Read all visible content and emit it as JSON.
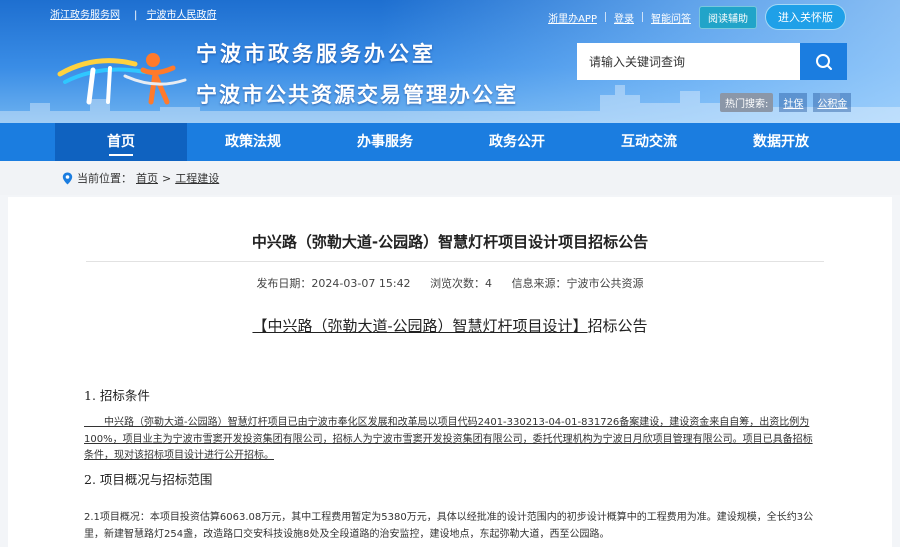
{
  "top_links": [
    "浙江政务服务网",
    "宁波市人民政府"
  ],
  "userbar": {
    "app": "浙里办APP",
    "login": "登录",
    "smart_qa": "智能问答",
    "assist": "阅读辅助",
    "old_version": "进入关怀版"
  },
  "header": {
    "title1": "宁波市政务服务办公室",
    "title2": "宁波市公共资源交易管理办公室"
  },
  "search": {
    "placeholder": "请输入关键词查询"
  },
  "hot_search": {
    "label": "热门搜索:",
    "tags": [
      "社保",
      "公积金"
    ]
  },
  "nav": {
    "items": [
      "首页",
      "政策法规",
      "办事服务",
      "政务公开",
      "互动交流",
      "数据开放"
    ],
    "active": "首页"
  },
  "breadcrumb": {
    "prefix": "当前位置：",
    "home": "首页",
    "sep": ">",
    "current": "工程建设"
  },
  "article": {
    "title": "中兴路（弥勒大道-公园路）智慧灯杆项目设计项目招标公告",
    "meta": {
      "date": "发布日期：2024-03-07 15:42",
      "views": "浏览次数：4",
      "source": "信息来源：宁波市公共资源"
    },
    "subtitle_bracketed": "【中兴路（弥勒大道-公园路）智慧灯杆项目设计】",
    "subtitle_rest": "招标公告",
    "sections": [
      {
        "heading": "1. 招标条件",
        "text": "　　中兴路（弥勒大道-公园路）智慧灯杆项目已由宁波市奉化区发展和改革局以项目代码2401-330213-04-01-831726备案建设，建设资金来自自筹，出资比例为100%，项目业主为宁波市雪窦开发投资集团有限公司，招标人为宁波市雪窦开发投资集团有限公司，委托代理机构为宁波日月欣项目管理有限公司。项目已具备招标 条件，现对该招标项目设计进行公开招标。"
      },
      {
        "heading": "2. 项目概况与招标范围",
        "text": "2.1项目概况：本项目投资估算6063.08万元，其中工程费用暂定为5380万元，具体以经批准的设计范围内的初步设计概算中的工程费用为准。建设规模，全长约3公里，新建智慧路灯254盏，改造路口交安科技设施8处及全段道路的治安监控，建设地点，东起弥勒大道，西至公园路。"
      }
    ]
  },
  "colors": {
    "nav_bg": "#1b7de0",
    "nav_active": "#0f62c0",
    "header_top": "#1e6fd0"
  }
}
